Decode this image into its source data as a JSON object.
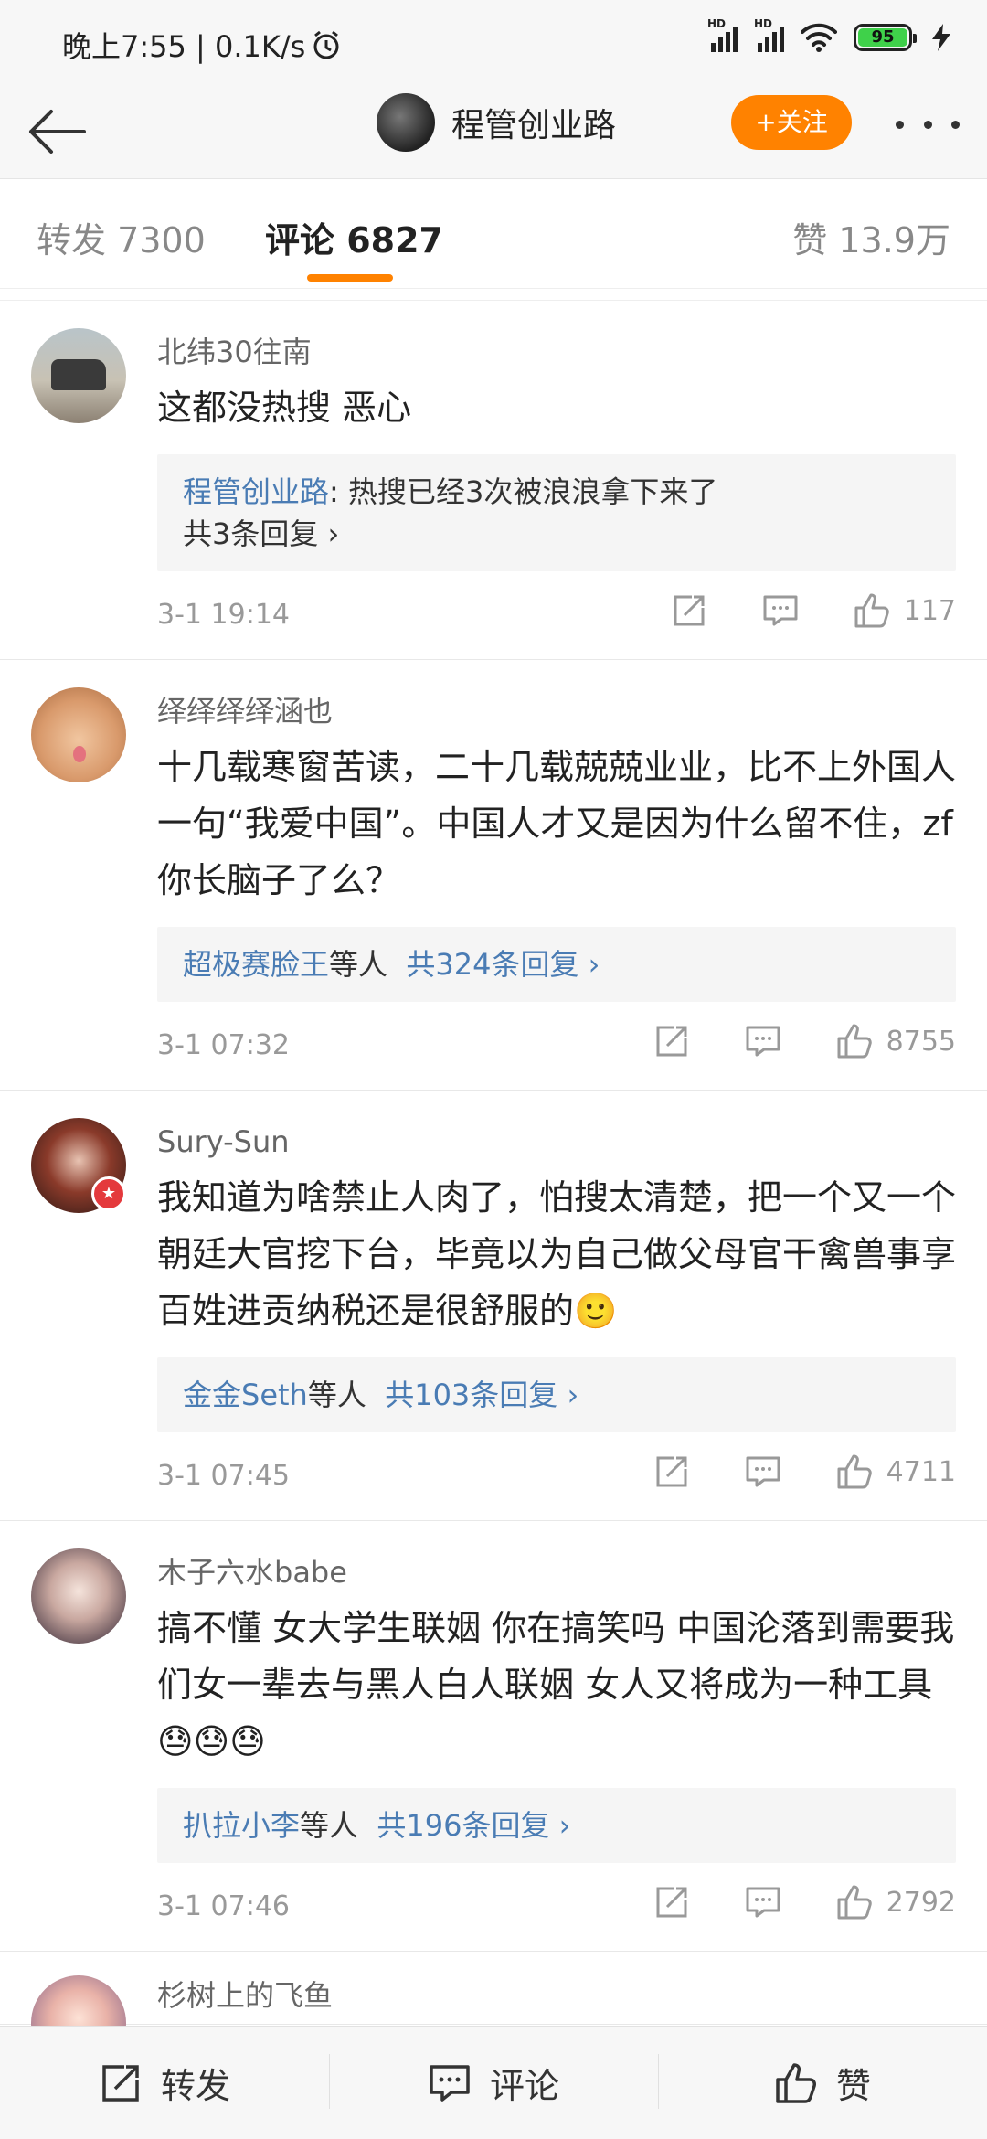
{
  "status_bar": {
    "time": "晚上7:55 | 0.1K/s",
    "hd1": "HD",
    "hd2": "HD",
    "battery": "95"
  },
  "header": {
    "title": "程管创业路",
    "follow_label": "+关注"
  },
  "tabs": {
    "repost": "转发 7300",
    "comment": "评论 6827",
    "like": "赞 13.9万"
  },
  "comments": [
    {
      "user": "北纬30往南",
      "text": "这都没热搜  恶心",
      "reply_author": "程管创业路",
      "reply_text": ": 热搜已经3次被浪浪拿下来了",
      "reply_count": "共3条回复 ›",
      "time": "3-1 19:14",
      "likes": "117"
    },
    {
      "user": "绎绎绎绎涵也",
      "text": "十几载寒窗苦读，二十几载兢兢业业，比不上外国人一句“我爱中国”。中国人才又是因为什么留不住，zf你长脑子了么？",
      "reply_author": "超极赛脸王",
      "reply_mid": "等人",
      "reply_count": "共324条回复 ›",
      "time": "3-1 07:32",
      "likes": "8755"
    },
    {
      "user": "Sury-Sun",
      "text": "我知道为啥禁止人肉了，怕搜太清楚，把一个又一个朝廷大官挖下台，毕竟以为自己做父母官干禽兽事享百姓进贡纳税还是很舒服的🙂",
      "reply_author": "金金Seth",
      "reply_mid": "等人",
      "reply_count": "共103条回复 ›",
      "time": "3-1 07:45",
      "likes": "4711"
    },
    {
      "user": "木子六水babe",
      "text": "搞不懂 女大学生联姻 你在搞笑吗 中国沦落到需要我们女一辈去与黑人白人联姻 女人又将成为一种工具😓😓😓",
      "reply_author": "扒拉小李",
      "reply_mid": "等人",
      "reply_count": "共196条回复 ›",
      "time": "3-1 07:46",
      "likes": "2792"
    },
    {
      "user": "杉树上的飞鱼"
    }
  ],
  "bottom_bar": {
    "repost": "转发",
    "comment": "评论",
    "like": "赞"
  }
}
